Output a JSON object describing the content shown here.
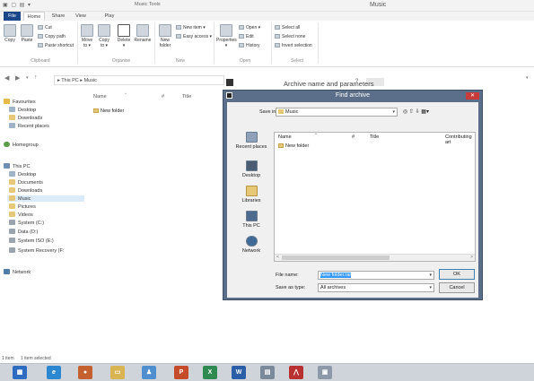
{
  "titlebar": {
    "quick_access": "▣ ▢ ▤ ▾",
    "context_tab": "Music Tools",
    "title": "Music"
  },
  "tabs": {
    "file": "File",
    "home": "Home",
    "share": "Share",
    "view": "View",
    "play": "Play"
  },
  "ribbon": {
    "clipboard": {
      "label": "Clipboard",
      "copy": "Copy",
      "paste": "Paste",
      "cut": "Cut",
      "copy_path": "Copy path",
      "paste_shortcut": "Paste shortcut"
    },
    "organise": {
      "label": "Organise",
      "move_to": "Move to ▾",
      "copy_to": "Copy to ▾",
      "delete": "Delete ▾",
      "rename": "Rename"
    },
    "new": {
      "label": "New",
      "new_folder": "New folder",
      "new_item": "New item ▾",
      "easy_access": "Easy access ▾"
    },
    "open": {
      "label": "Open",
      "properties": "Properties ▾",
      "open": "Open ▾",
      "edit": "Edit",
      "history": "History"
    },
    "select": {
      "label": "Select",
      "select_all": "Select all",
      "select_none": "Select none",
      "invert": "Invert selection"
    }
  },
  "address": {
    "back": "◀",
    "forward": "▶",
    "recent": "▾",
    "up": "↑",
    "path": "▸ This PC ▸ Music",
    "far_right": "▾"
  },
  "nav": {
    "favourites": "Favourites",
    "desktop": "Desktop",
    "downloads": "Downloads",
    "recent": "Recent places",
    "homegroup": "Homegroup",
    "thispc": "This PC",
    "pc_desktop": "Desktop",
    "documents": "Documents",
    "pc_downloads": "Downloads",
    "music": "Music",
    "pictures": "Pictures",
    "videos": "Videos",
    "system_c": "System (C:)",
    "data_d": "Data (D:)",
    "system_iso": "System ISO (E:)",
    "sys_recovery": "System Recovery (F:",
    "network": "Network"
  },
  "list": {
    "col_name": "Name",
    "col_num": "#",
    "col_title": "Title",
    "item1": "New folder"
  },
  "bg_dialog": {
    "title": "Archive name and parameters",
    "help": "?",
    "close": "✕"
  },
  "dialog": {
    "title": "Find archive",
    "close": "✕",
    "save_in_label": "Save in:",
    "save_in_value": "Music",
    "tools": "◎ ⇧ ⇩ ▦▾",
    "places": {
      "recent": "Recent places",
      "desktop": "Desktop",
      "libraries": "Libraries",
      "thispc": "This PC",
      "network": "Network"
    },
    "cols": {
      "name": "Name",
      "num": "#",
      "title": "Title",
      "contrib": "Contributing art"
    },
    "file1": "New folder",
    "filename_label": "File name:",
    "filename_value": "New folder.rar",
    "saveas_label": "Save as type:",
    "saveas_value": "All archives",
    "ok": "OK",
    "cancel": "Cancel"
  },
  "status": {
    "count": "1 item",
    "selected": "1 item selected"
  },
  "taskbar": {
    "ie": "e",
    "ppt": "P",
    "xl": "X",
    "wd": "W"
  }
}
